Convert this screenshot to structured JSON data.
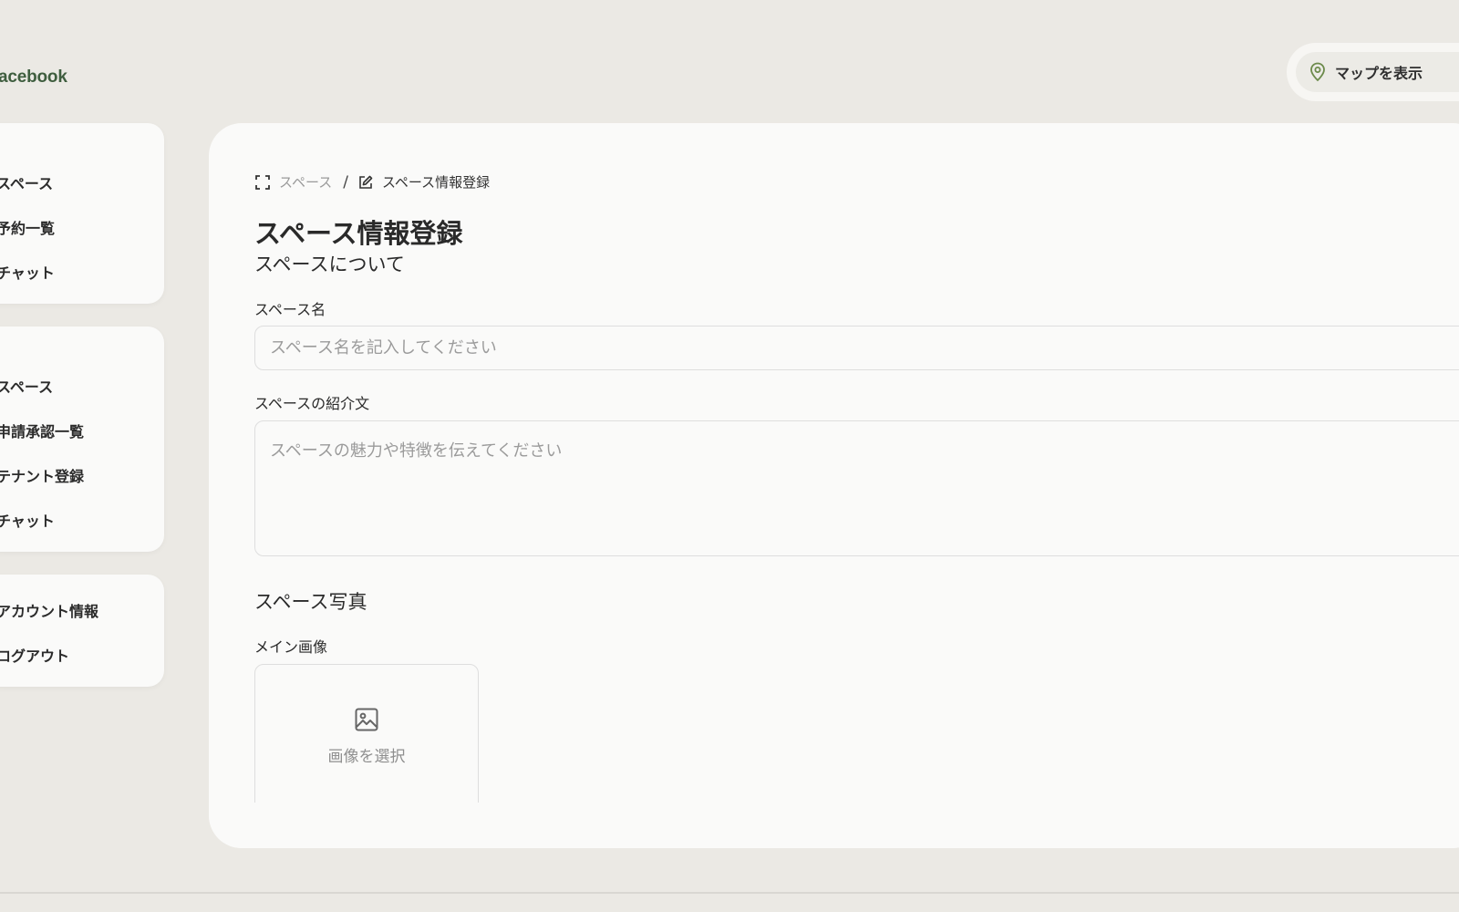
{
  "brand": {
    "logo_text": "acebook"
  },
  "header": {
    "map_button_label": "マップを表示"
  },
  "sidebar": {
    "groups": [
      {
        "items": [
          {
            "label": "スペース"
          },
          {
            "label": "予約一覧"
          },
          {
            "label": "チャット"
          }
        ]
      },
      {
        "items": [
          {
            "label": "スペース"
          },
          {
            "label": "申請承認一覧"
          },
          {
            "label": "テナント登録"
          },
          {
            "label": "チャット"
          }
        ]
      },
      {
        "items": [
          {
            "label": "アカウント情報"
          },
          {
            "label": "ログアウト"
          }
        ]
      }
    ]
  },
  "breadcrumb": {
    "parent": "スペース",
    "separator": "/",
    "current": "スペース情報登録"
  },
  "main": {
    "page_title": "スペース情報登録",
    "section_about": "スペースについて",
    "space_name_label": "スペース名",
    "space_name_value": "",
    "space_name_placeholder": "スペース名を記入してください",
    "description_label": "スペースの紹介文",
    "description_value": "",
    "description_placeholder": "スペースの魅力や特徴を伝えてください",
    "section_photos": "スペース写真",
    "main_image_label": "メイン画像",
    "image_picker_label": "画像を選択"
  },
  "colors": {
    "background": "#ebe9e4",
    "card": "#fafaf9",
    "brand": "#3f5e3f",
    "map_pin": "#6b8a4a"
  },
  "icons": {
    "map": "map-pin-icon",
    "breadcrumb_parent": "focus-frame-icon",
    "breadcrumb_current": "edit-icon",
    "image_picker": "image-icon"
  }
}
